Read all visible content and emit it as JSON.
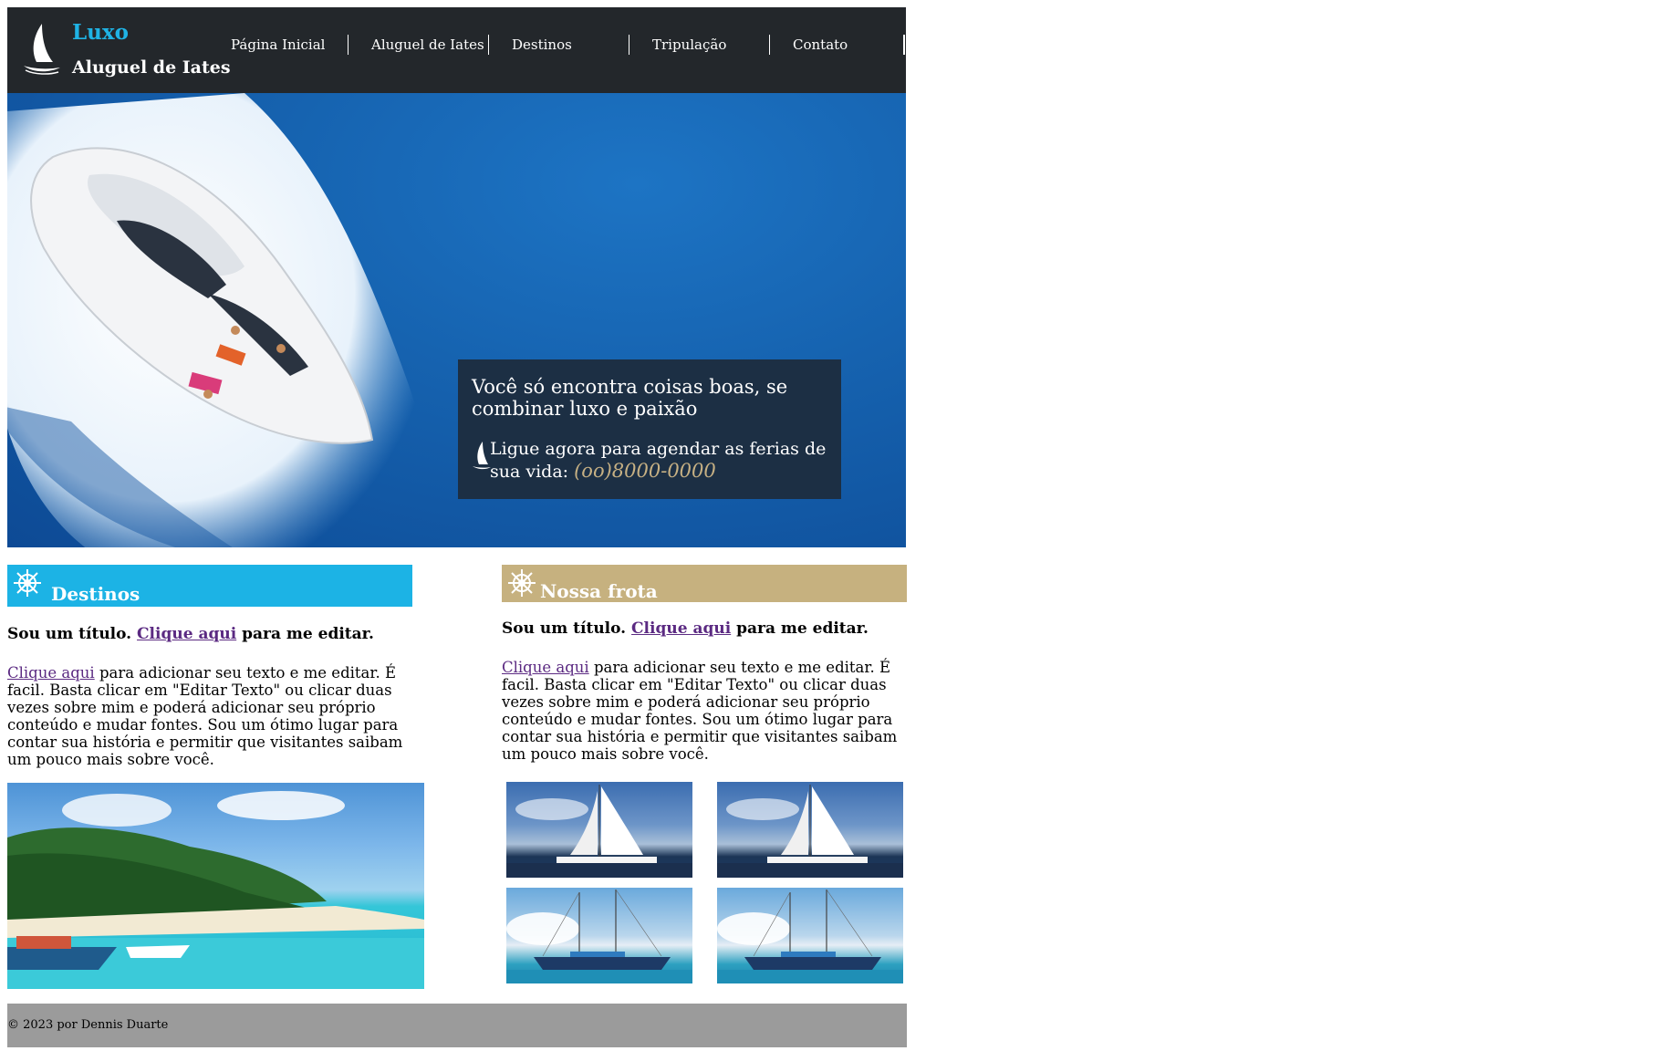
{
  "header": {
    "brand_line1": "Luxo",
    "brand_line2": "Aluguel de Iates",
    "logo_icon": "sailboat-icon",
    "nav": [
      {
        "label": "Página Inicial"
      },
      {
        "label": "Aluguel de Iates"
      },
      {
        "label": "Destinos"
      },
      {
        "label": "Tripulação"
      },
      {
        "label": "Contato"
      }
    ]
  },
  "hero": {
    "image": "yacht-photo",
    "headline": "Você só encontra coisas boas, se combinar luxo e paixão",
    "call_text": "Ligue agora para agendar as ferias de sua vida:",
    "phone": "(oo)8000-0000",
    "icon": "sailboat-icon"
  },
  "destinos": {
    "heading": "Destinos",
    "icon": "ship-wheel-icon",
    "subtitle_prefix": "Sou um título.",
    "subtitle_link": "Clique aqui",
    "subtitle_suffix": "para me editar.",
    "body_link": "Clique aqui",
    "body_text": "para adicionar seu texto e me editar. É facil. Basta clicar em \"Editar Texto\" ou clicar duas vezes sobre mim e poderá adicionar seu próprio conteúdo e mudar fontes. Sou um ótimo lugar para contar sua história e permitir que visitantes saibam um pouco mais sobre você.",
    "image": "tropical-beach-photo"
  },
  "frota": {
    "heading": "Nossa frota",
    "icon": "ship-wheel-icon",
    "subtitle_prefix": "Sou um título.",
    "subtitle_link": "Clique aqui",
    "subtitle_suffix": "para me editar.",
    "body_link": "Clique aqui",
    "body_text": "para adicionar seu texto e me editar. É facil. Basta clicar em \"Editar Texto\" ou clicar duas vezes sobre mim e poderá adicionar seu próprio conteúdo e mudar fontes. Sou um ótimo lugar para contar sua história e permitir que visitantes saibam um pouco mais sobre você.",
    "thumbnails": [
      "sailboat-photo",
      "sailboat-photo",
      "schooner-photo",
      "schooner-photo"
    ]
  },
  "footer": {
    "text": "© 2023 por Dennis Duarte"
  },
  "colors": {
    "header_bg": "#23272b",
    "accent_blue": "#1cb3e5",
    "accent_tan": "#c6b17f",
    "hero_box_bg": "#1c2f44",
    "phone": "#c7b184",
    "link": "#5b2a82",
    "footer_bg": "#9b9b9b"
  }
}
